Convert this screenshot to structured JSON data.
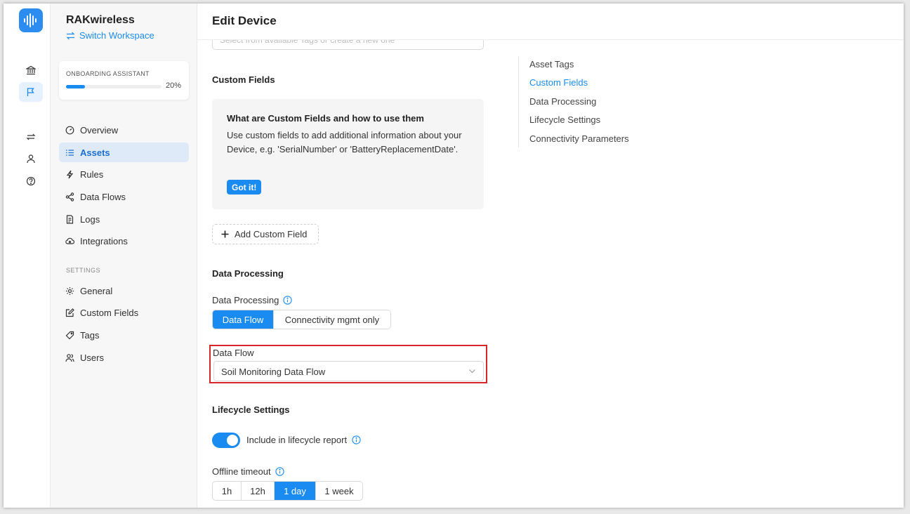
{
  "colors": {
    "accent": "#1a8bf0",
    "highlight_border": "#d9262a"
  },
  "sidebar": {
    "brand": "RAKwireless",
    "switch_workspace": "Switch Workspace",
    "onboarding": {
      "title": "ONBOARDING ASSISTANT",
      "progress_label": "20%",
      "progress": 0.2
    },
    "nav": [
      {
        "label": "Overview",
        "icon": "dashboard-icon"
      },
      {
        "label": "Assets",
        "icon": "list-icon",
        "active": true
      },
      {
        "label": "Rules",
        "icon": "lightning-icon"
      },
      {
        "label": "Data Flows",
        "icon": "share-icon"
      },
      {
        "label": "Logs",
        "icon": "file-icon"
      },
      {
        "label": "Integrations",
        "icon": "cloud-icon"
      }
    ],
    "settings_header": "SETTINGS",
    "settings": [
      {
        "label": "General",
        "icon": "gear-icon"
      },
      {
        "label": "Custom Fields",
        "icon": "edit-icon"
      },
      {
        "label": "Tags",
        "icon": "tag-icon"
      },
      {
        "label": "Users",
        "icon": "users-icon"
      }
    ]
  },
  "rail": {
    "icons": [
      "bank-icon",
      "flag-icon",
      "switch-icon",
      "user-icon",
      "help-icon"
    ]
  },
  "main": {
    "title": "Edit Device",
    "tags_placeholder": "Select from available Tags or create a new one",
    "custom_fields": {
      "title": "Custom Fields",
      "help_title": "What are Custom Fields and how to use them",
      "help_body": "Use custom fields to add additional information about your Device, e.g. 'SerialNumber' or 'BatteryReplacementDate'.",
      "got_it": "Got it!",
      "add_button": "Add Custom Field"
    },
    "data_processing": {
      "title": "Data Processing",
      "label": "Data Processing",
      "options": [
        "Data Flow",
        "Connectivity mgmt only"
      ],
      "selected": "Data Flow",
      "data_flow_label": "Data Flow",
      "data_flow_value": "Soil Monitoring Data Flow"
    },
    "lifecycle": {
      "title": "Lifecycle Settings",
      "include_label": "Include in lifecycle report",
      "include_enabled": true,
      "offline_label": "Offline timeout",
      "timeouts": [
        "1h",
        "12h",
        "1 day",
        "1 week"
      ],
      "selected_timeout": "1 day"
    }
  },
  "anchors": [
    {
      "label": "Asset Tags"
    },
    {
      "label": "Custom Fields",
      "active": true
    },
    {
      "label": "Data Processing"
    },
    {
      "label": "Lifecycle Settings"
    },
    {
      "label": "Connectivity Parameters"
    }
  ]
}
